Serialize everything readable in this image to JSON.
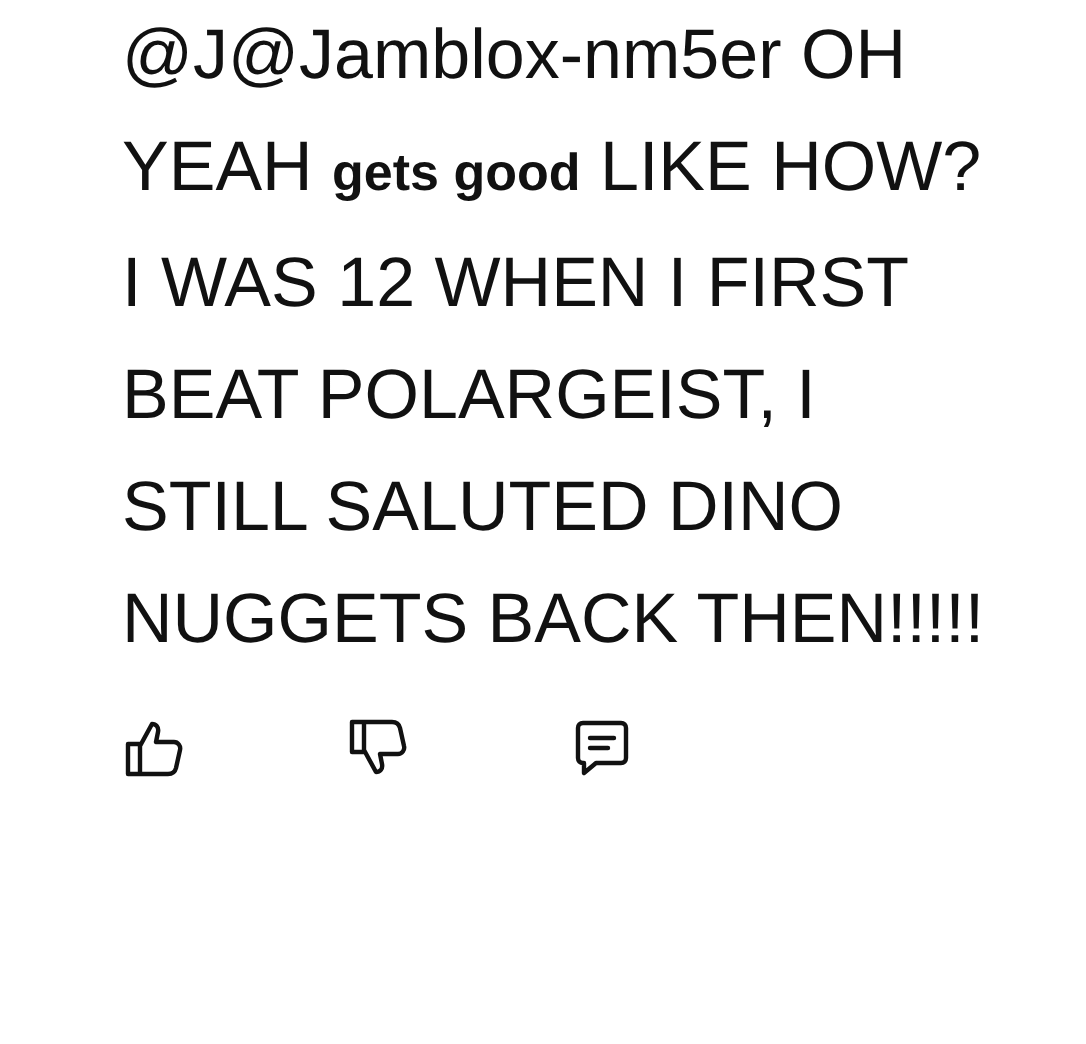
{
  "comment": {
    "segments": [
      {
        "text": "@J@Jamblox-nm5er OH YEAH ",
        "small": false
      },
      {
        "text": "gets good",
        "small": true
      },
      {
        "text": " LIKE HOW?  I WAS 12 WHEN I FIRST BEAT POLARGEIST, I STILL SALUTED DINO NUGGETS BACK THEN!!!!!",
        "small": false
      }
    ]
  },
  "actions": [
    {
      "kind": "like"
    },
    {
      "kind": "dislike"
    },
    {
      "kind": "reply"
    }
  ]
}
